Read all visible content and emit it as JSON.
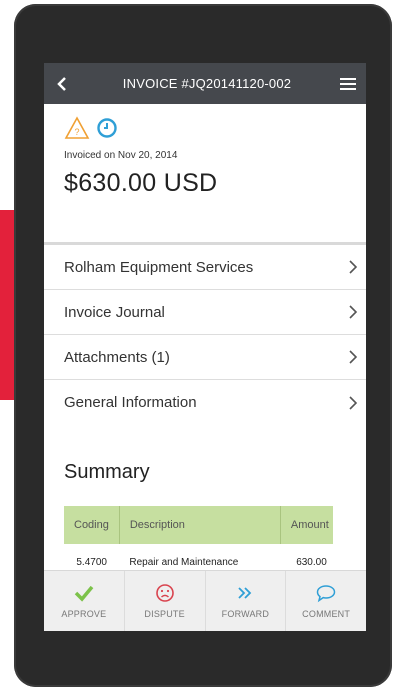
{
  "appbar": {
    "title": "INVOICE #JQ20141120-002"
  },
  "header": {
    "invoiced_on": "Invoiced on Nov 20, 2014",
    "amount": "$630.00 USD",
    "icons": [
      "warning-icon",
      "clock-icon"
    ]
  },
  "rows": [
    {
      "label": "Rolham Equipment Services"
    },
    {
      "label": "Invoice Journal"
    },
    {
      "label": "Attachments (1)"
    },
    {
      "label": "General Information"
    }
  ],
  "summary": {
    "title": "Summary",
    "columns": [
      "Coding",
      "Description",
      "Amount"
    ],
    "rows": [
      [
        "5.4700",
        "Repair and Maintenance",
        "630.00"
      ]
    ]
  },
  "actions": [
    {
      "label": "APPROVE",
      "icon": "check-icon",
      "color": "#7cc24a"
    },
    {
      "label": "DISPUTE",
      "icon": "sad-face-icon",
      "color": "#d9434e"
    },
    {
      "label": "FORWARD",
      "icon": "double-chevron-right-icon",
      "color": "#2f9fd6"
    },
    {
      "label": "COMMENT",
      "icon": "speech-bubble-icon",
      "color": "#2f9fd6"
    }
  ],
  "colors": {
    "appbar": "#45484d",
    "table_header": "#c6dfa0",
    "brand_red": "#e3213b",
    "warning": "#f0a033",
    "clock": "#2f9fd6"
  }
}
